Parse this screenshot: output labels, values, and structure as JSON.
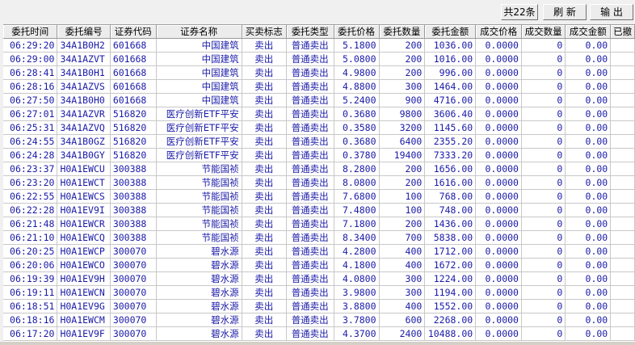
{
  "toolbar": {
    "count_label": "共22条",
    "refresh_label": "刷 新",
    "export_label": "输 出"
  },
  "columns": [
    "委托时间",
    "委托编号",
    "证券代码",
    "证券名称",
    "买卖标志",
    "委托类型",
    "委托价格",
    "委托数量",
    "委托金额",
    "成交价格",
    "成交数量",
    "成交金额",
    "已撤"
  ],
  "rows": [
    [
      "06:29:20",
      "34A1B0H2",
      "601668",
      "中国建筑",
      "卖出",
      "普通卖出",
      "5.1800",
      "200",
      "1036.00",
      "0.0000",
      "0",
      "0.00"
    ],
    [
      "06:29:00",
      "34A1AZVT",
      "601668",
      "中国建筑",
      "卖出",
      "普通卖出",
      "5.0800",
      "200",
      "1016.00",
      "0.0000",
      "0",
      "0.00"
    ],
    [
      "06:28:41",
      "34A1B0H1",
      "601668",
      "中国建筑",
      "卖出",
      "普通卖出",
      "4.9800",
      "200",
      "996.00",
      "0.0000",
      "0",
      "0.00"
    ],
    [
      "06:28:16",
      "34A1AZVS",
      "601668",
      "中国建筑",
      "卖出",
      "普通卖出",
      "4.8800",
      "300",
      "1464.00",
      "0.0000",
      "0",
      "0.00"
    ],
    [
      "06:27:50",
      "34A1B0H0",
      "601668",
      "中国建筑",
      "卖出",
      "普通卖出",
      "5.2400",
      "900",
      "4716.00",
      "0.0000",
      "0",
      "0.00"
    ],
    [
      "06:27:01",
      "34A1AZVR",
      "516820",
      "医疗创新ETF平安",
      "卖出",
      "普通卖出",
      "0.3680",
      "9800",
      "3606.40",
      "0.0000",
      "0",
      "0.00"
    ],
    [
      "06:25:31",
      "34A1AZVQ",
      "516820",
      "医疗创新ETF平安",
      "卖出",
      "普通卖出",
      "0.3580",
      "3200",
      "1145.60",
      "0.0000",
      "0",
      "0.00"
    ],
    [
      "06:24:55",
      "34A1B0GZ",
      "516820",
      "医疗创新ETF平安",
      "卖出",
      "普通卖出",
      "0.3680",
      "6400",
      "2355.20",
      "0.0000",
      "0",
      "0.00"
    ],
    [
      "06:24:28",
      "34A1B0GY",
      "516820",
      "医疗创新ETF平安",
      "卖出",
      "普通卖出",
      "0.3780",
      "19400",
      "7333.20",
      "0.0000",
      "0",
      "0.00"
    ],
    [
      "06:23:37",
      "H0A1EWCU",
      "300388",
      "节能国祯",
      "卖出",
      "普通卖出",
      "8.2800",
      "200",
      "1656.00",
      "0.0000",
      "0",
      "0.00"
    ],
    [
      "06:23:20",
      "H0A1EWCT",
      "300388",
      "节能国祯",
      "卖出",
      "普通卖出",
      "8.0800",
      "200",
      "1616.00",
      "0.0000",
      "0",
      "0.00"
    ],
    [
      "06:22:55",
      "H0A1EWCS",
      "300388",
      "节能国祯",
      "卖出",
      "普通卖出",
      "7.6800",
      "100",
      "768.00",
      "0.0000",
      "0",
      "0.00"
    ],
    [
      "06:22:28",
      "H0A1EV9I",
      "300388",
      "节能国祯",
      "卖出",
      "普通卖出",
      "7.4800",
      "100",
      "748.00",
      "0.0000",
      "0",
      "0.00"
    ],
    [
      "06:21:48",
      "H0A1EWCR",
      "300388",
      "节能国祯",
      "卖出",
      "普通卖出",
      "7.1800",
      "200",
      "1436.00",
      "0.0000",
      "0",
      "0.00"
    ],
    [
      "06:21:10",
      "H0A1EWCQ",
      "300388",
      "节能国祯",
      "卖出",
      "普通卖出",
      "8.3400",
      "700",
      "5838.00",
      "0.0000",
      "0",
      "0.00"
    ],
    [
      "06:20:25",
      "H0A1EWCP",
      "300070",
      "碧水源",
      "卖出",
      "普通卖出",
      "4.2800",
      "400",
      "1712.00",
      "0.0000",
      "0",
      "0.00"
    ],
    [
      "06:20:06",
      "H0A1EWCO",
      "300070",
      "碧水源",
      "卖出",
      "普通卖出",
      "4.1800",
      "400",
      "1672.00",
      "0.0000",
      "0",
      "0.00"
    ],
    [
      "06:19:39",
      "H0A1EV9H",
      "300070",
      "碧水源",
      "卖出",
      "普通卖出",
      "4.0800",
      "300",
      "1224.00",
      "0.0000",
      "0",
      "0.00"
    ],
    [
      "06:19:11",
      "H0A1EWCN",
      "300070",
      "碧水源",
      "卖出",
      "普通卖出",
      "3.9800",
      "300",
      "1194.00",
      "0.0000",
      "0",
      "0.00"
    ],
    [
      "06:18:51",
      "H0A1EV9G",
      "300070",
      "碧水源",
      "卖出",
      "普通卖出",
      "3.8800",
      "400",
      "1552.00",
      "0.0000",
      "0",
      "0.00"
    ],
    [
      "06:18:16",
      "H0A1EWCM",
      "300070",
      "碧水源",
      "卖出",
      "普通卖出",
      "3.7800",
      "600",
      "2268.00",
      "0.0000",
      "0",
      "0.00"
    ],
    [
      "06:17:20",
      "H0A1EV9F",
      "300070",
      "碧水源",
      "卖出",
      "普通卖出",
      "4.3700",
      "2400",
      "10488.00",
      "0.0000",
      "0",
      "0.00"
    ]
  ]
}
